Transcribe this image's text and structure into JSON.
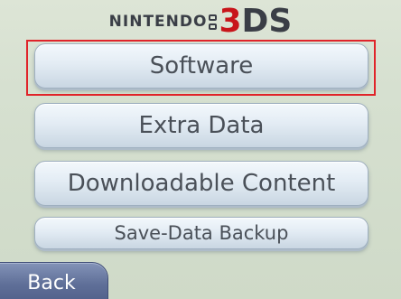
{
  "header": {
    "brand_nintendo": "NINTENDO",
    "brand_3": "3",
    "brand_ds": "DS"
  },
  "menu": {
    "items": [
      {
        "label": "Software"
      },
      {
        "label": "Extra Data"
      },
      {
        "label": "Downloadable Content"
      },
      {
        "label": "Save-Data Backup"
      }
    ],
    "selected_index": 0
  },
  "footer": {
    "back_label": "Back"
  },
  "colors": {
    "background": "#d6e0d0",
    "button_text": "#4a5058",
    "highlight": "#e0242a",
    "back_button": "#5f6f98",
    "logo_red": "#c8151b"
  }
}
